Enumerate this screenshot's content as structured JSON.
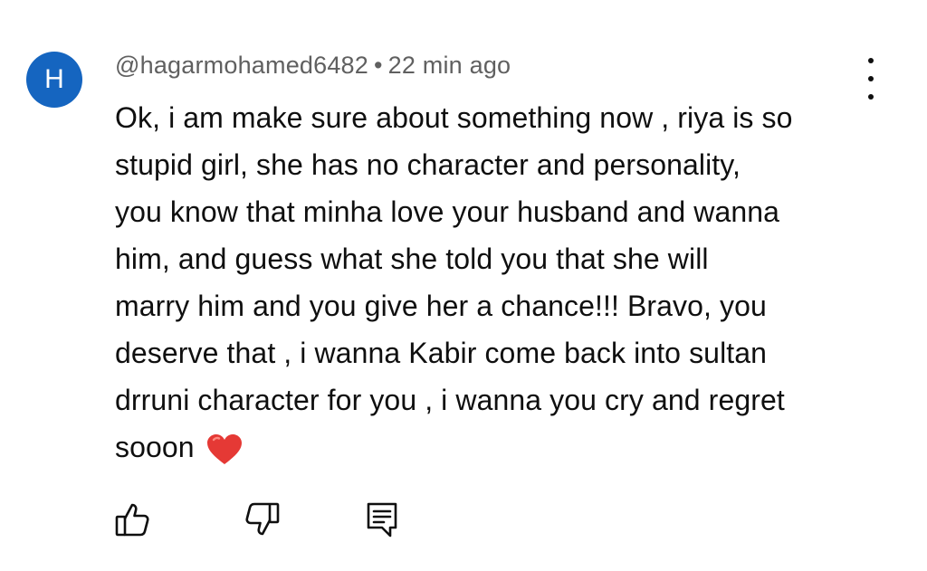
{
  "comment": {
    "avatar_letter": "H",
    "avatar_color": "#1565c0",
    "author": "@hagarmohamed6482",
    "separator": "•",
    "time": "22 min ago",
    "text_lines": [
      "Ok, i am make sure about something now , riya is so",
      "stupid girl, she has no character and personality,",
      "you know that minha love your husband and wanna",
      "him, and guess what she told you that she will",
      "marry him and you give her a chance!!! Bravo, you",
      "deserve that , i wanna Kabir come back into sultan",
      "drruni character for you , i wanna you cry and regret",
      "sooon"
    ],
    "emoji": "heart-emoji"
  },
  "icons": {
    "more": "more-vert-icon",
    "like": "thumb-up-icon",
    "dislike": "thumb-down-icon",
    "reply": "reply-comment-icon"
  }
}
